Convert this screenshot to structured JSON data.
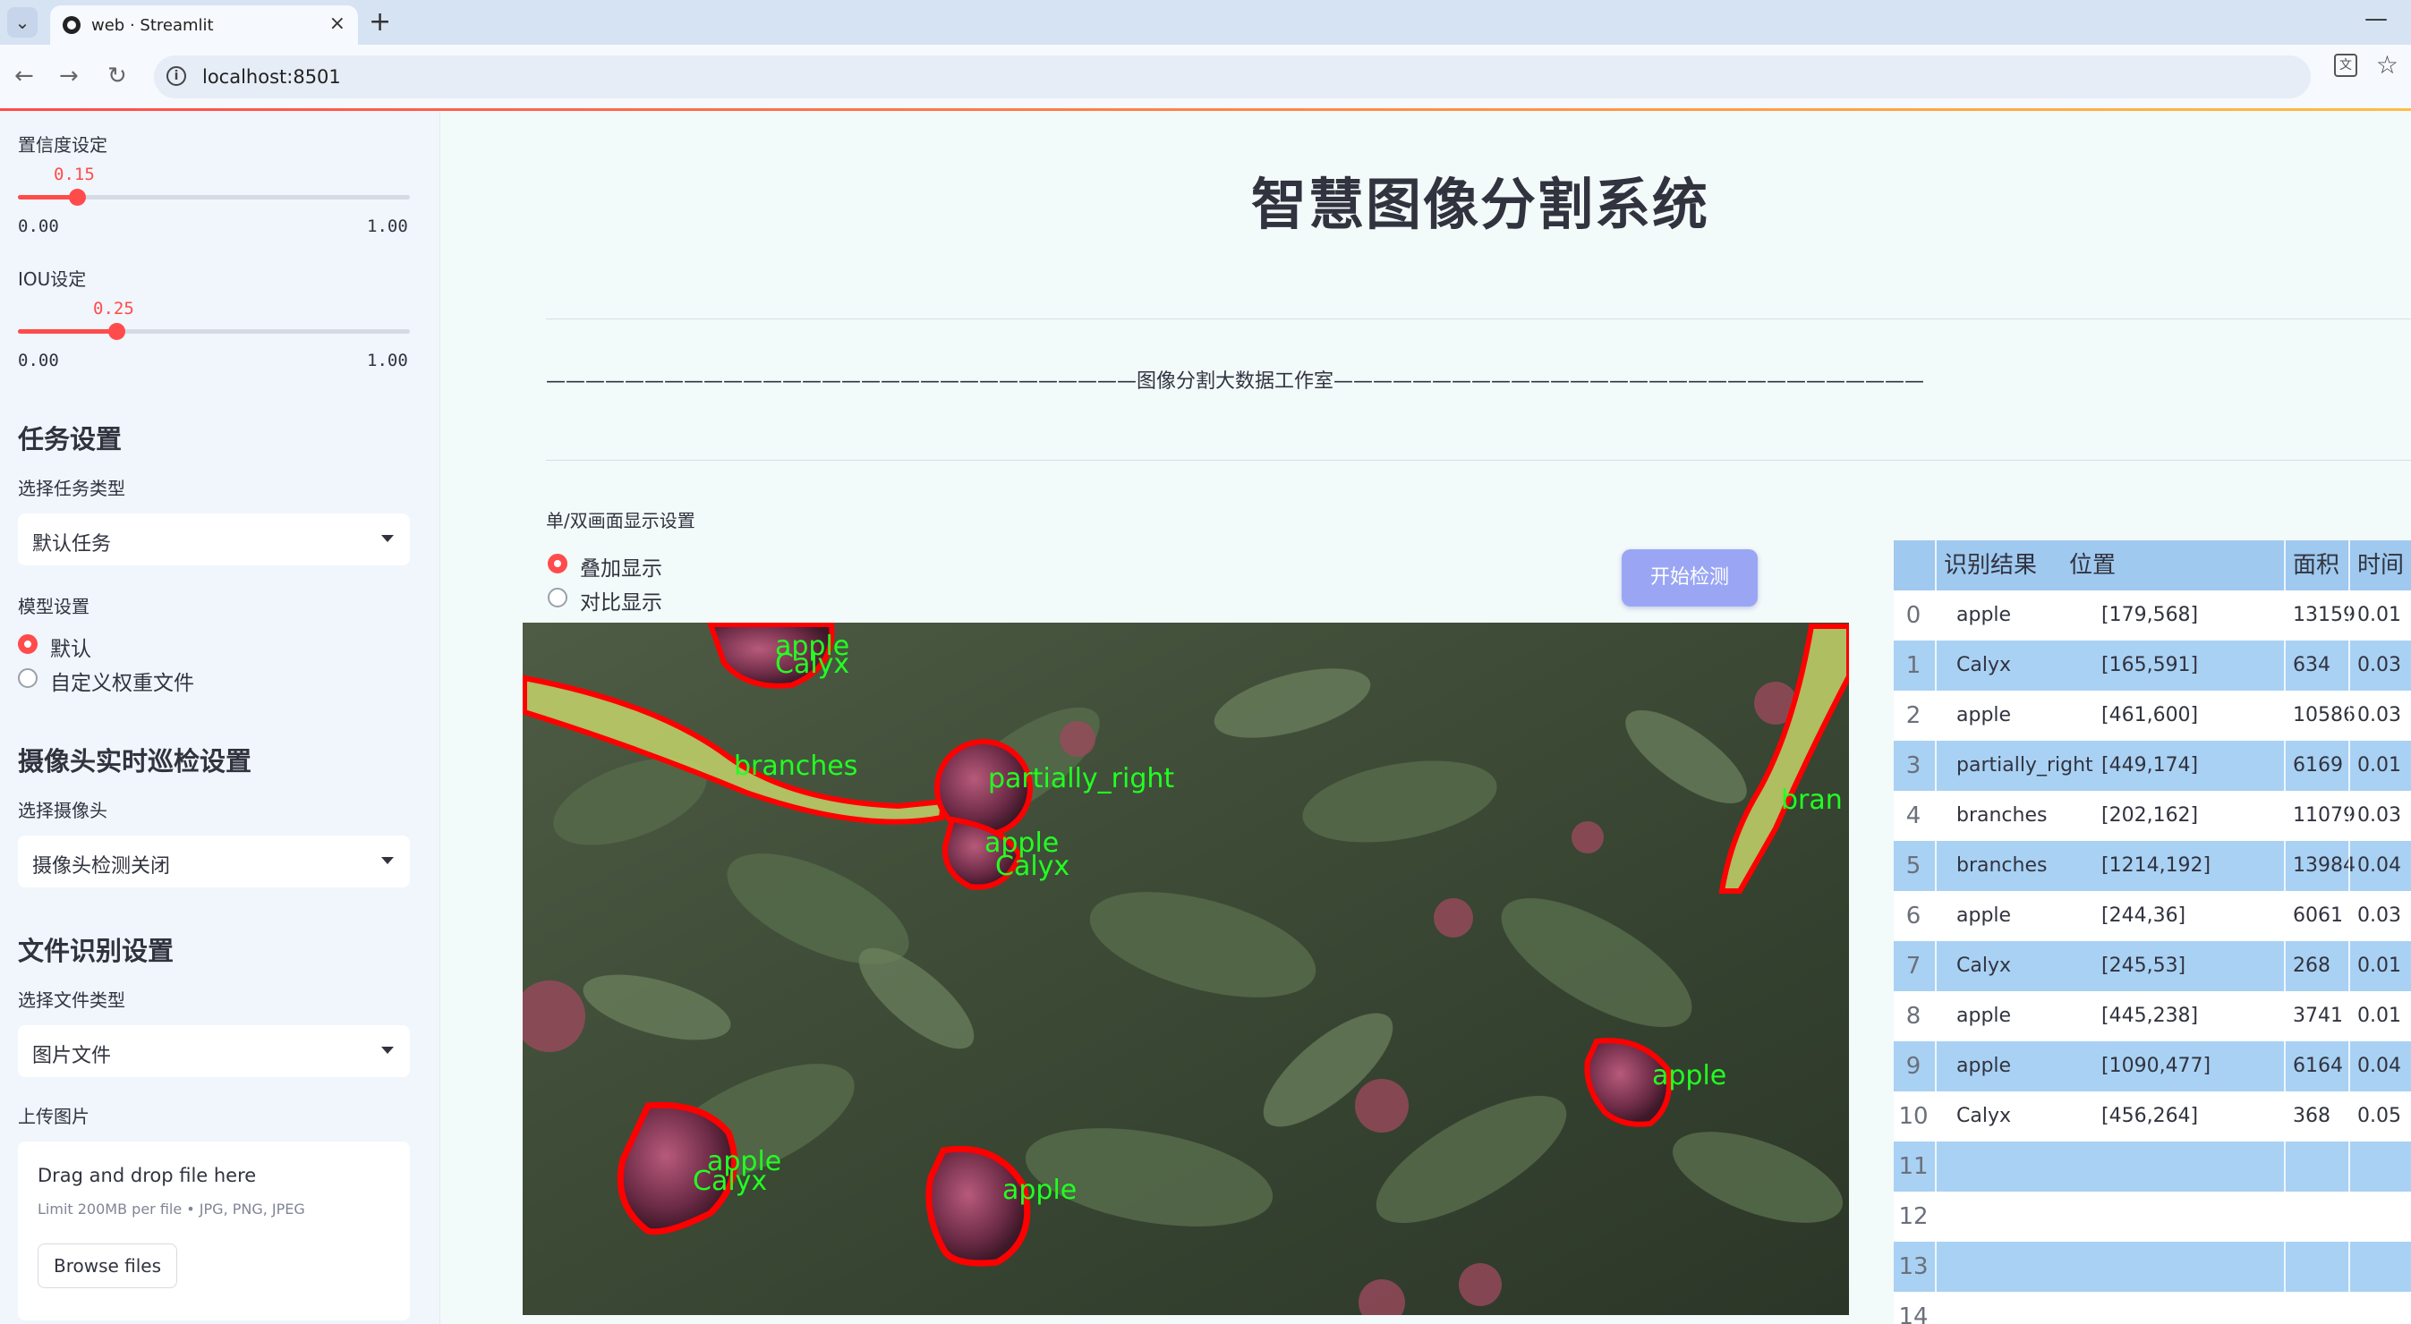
{
  "browser": {
    "tab_title": "web · Streamlit",
    "url": "localhost:8501"
  },
  "sidebar": {
    "confidence": {
      "label": "置信度设定",
      "value": "0.15",
      "min": "0.00",
      "max": "1.00",
      "fraction": 0.15
    },
    "iou": {
      "label": "IOU设定",
      "value": "0.25",
      "min": "0.00",
      "max": "1.00",
      "fraction": 0.25
    },
    "task_heading": "任务设置",
    "task_type_label": "选择任务类型",
    "task_type_value": "默认任务",
    "model_label": "模型设置",
    "model_options": [
      {
        "label": "默认",
        "selected": true
      },
      {
        "label": "自定义权重文件",
        "selected": false
      }
    ],
    "camera_heading": "摄像头实时巡检设置",
    "camera_label": "选择摄像头",
    "camera_value": "摄像头检测关闭",
    "file_heading": "文件识别设置",
    "file_type_label": "选择文件类型",
    "file_type_value": "图片文件",
    "upload_label": "上传图片",
    "upload_title": "Drag and drop file here",
    "upload_limits": "Limit 200MB per file • JPG, PNG, JPEG",
    "browse_label": "Browse files"
  },
  "main": {
    "title": "智慧图像分割系统",
    "studio_line": "——————————————————————————————图像分割大数据工作室——————————————————————————————",
    "display_label": "单/双画面显示设置",
    "display_options": [
      {
        "label": "叠加显示",
        "selected": true
      },
      {
        "label": "对比显示",
        "selected": false
      }
    ],
    "start_button": "开始检测"
  },
  "detections": {
    "labels": [
      "apple",
      "Calyx",
      "branches",
      "partially_right",
      "apple",
      "Calyx",
      "apple",
      "Calyx",
      "apple",
      "apple",
      "bran"
    ]
  },
  "table": {
    "headers": [
      "识别结果",
      "位置",
      "面积",
      "时间"
    ],
    "rows": [
      {
        "idx": "0",
        "result": "apple",
        "pos": "[179,568]",
        "area": "13159",
        "time": "0.01"
      },
      {
        "idx": "1",
        "result": "Calyx",
        "pos": "[165,591]",
        "area": "634",
        "time": "0.03"
      },
      {
        "idx": "2",
        "result": "apple",
        "pos": "[461,600]",
        "area": "10586",
        "time": "0.03"
      },
      {
        "idx": "3",
        "result": "partially_right",
        "pos": "[449,174]",
        "area": "6169",
        "time": "0.01"
      },
      {
        "idx": "4",
        "result": "branches",
        "pos": "[202,162]",
        "area": "11079",
        "time": "0.03"
      },
      {
        "idx": "5",
        "result": "branches",
        "pos": "[1214,192]",
        "area": "13984",
        "time": "0.04"
      },
      {
        "idx": "6",
        "result": "apple",
        "pos": "[244,36]",
        "area": "6061",
        "time": "0.03"
      },
      {
        "idx": "7",
        "result": "Calyx",
        "pos": "[245,53]",
        "area": "268",
        "time": "0.01"
      },
      {
        "idx": "8",
        "result": "apple",
        "pos": "[445,238]",
        "area": "3741",
        "time": "0.01"
      },
      {
        "idx": "9",
        "result": "apple",
        "pos": "[1090,477]",
        "area": "6164",
        "time": "0.04"
      },
      {
        "idx": "10",
        "result": "Calyx",
        "pos": "[456,264]",
        "area": "368",
        "time": "0.05"
      },
      {
        "idx": "11",
        "result": "",
        "pos": "",
        "area": "",
        "time": ""
      },
      {
        "idx": "12",
        "result": "",
        "pos": "",
        "area": "",
        "time": ""
      },
      {
        "idx": "13",
        "result": "",
        "pos": "",
        "area": "",
        "time": ""
      },
      {
        "idx": "14",
        "result": "",
        "pos": "",
        "area": "",
        "time": ""
      }
    ]
  },
  "colors": {
    "accent": "#ff4b4b",
    "button": "#9aa6f4",
    "table_header": "#9fc9ef",
    "mask_outline": "#ff0000",
    "label_text": "#22ff22"
  }
}
